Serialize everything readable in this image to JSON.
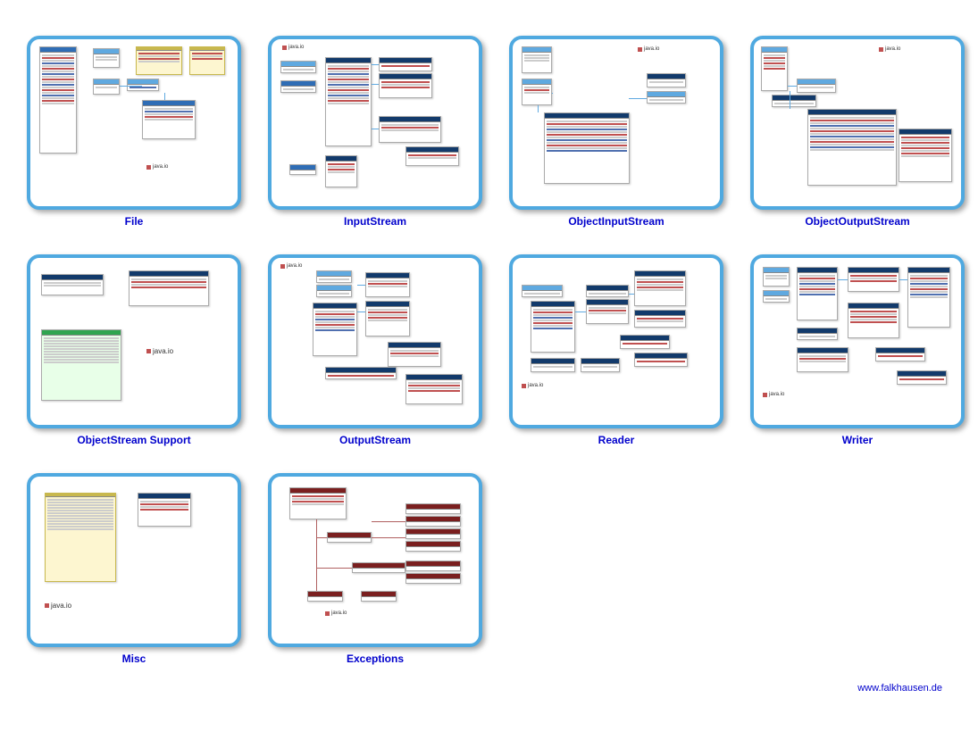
{
  "items": [
    {
      "label": "File",
      "pkg": "java.io"
    },
    {
      "label": "InputStream",
      "pkg": "java.io"
    },
    {
      "label": "ObjectInputStream",
      "pkg": "java.io"
    },
    {
      "label": "ObjectOutputStream",
      "pkg": "java.io"
    },
    {
      "label": "ObjectStream Support",
      "pkg": "java.io"
    },
    {
      "label": "OutputStream",
      "pkg": "java.io"
    },
    {
      "label": "Reader",
      "pkg": "java.io"
    },
    {
      "label": "Writer",
      "pkg": "java.io"
    },
    {
      "label": "Misc",
      "pkg": "java.io"
    },
    {
      "label": "Exceptions",
      "pkg": "java.io"
    }
  ],
  "footer": "www.falkhausen.de"
}
